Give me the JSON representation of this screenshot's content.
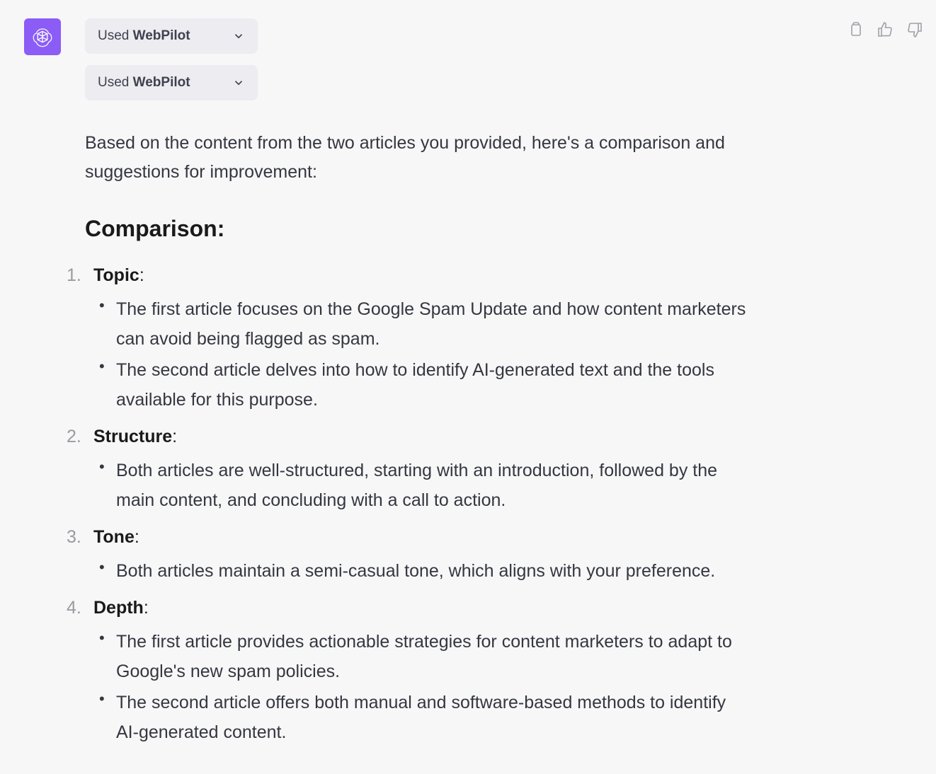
{
  "plugin_chips": [
    {
      "prefix": "Used ",
      "name": "WebPilot"
    },
    {
      "prefix": "Used ",
      "name": "WebPilot"
    }
  ],
  "intro": "Based on the content from the two articles you provided, here's a comparison and suggestions for improvement:",
  "section_heading": "Comparison:",
  "items": [
    {
      "title": "Topic",
      "bullets": [
        "The first article focuses on the Google Spam Update and how content marketers can avoid being flagged as spam.",
        "The second article delves into how to identify AI-generated text and the tools available for this purpose."
      ]
    },
    {
      "title": "Structure",
      "bullets": [
        "Both articles are well-structured, starting with an introduction, followed by the main content, and concluding with a call to action."
      ]
    },
    {
      "title": "Tone",
      "bullets": [
        "Both articles maintain a semi-casual tone, which aligns with your preference."
      ]
    },
    {
      "title": "Depth",
      "bullets": [
        "The first article provides actionable strategies for content marketers to adapt to Google's new spam policies.",
        "The second article offers both manual and software-based methods to identify AI-generated content."
      ]
    }
  ]
}
